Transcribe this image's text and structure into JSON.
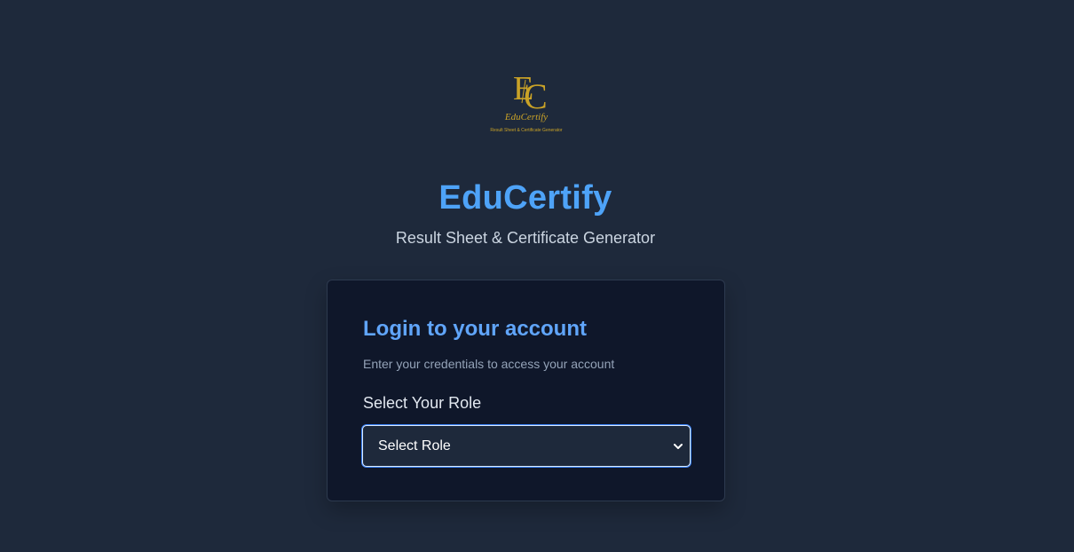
{
  "logo": {
    "monogram_e": "E",
    "monogram_c": "C",
    "wordmark": "EduCertify",
    "tagline": "Result Sheet & Certificate Generator",
    "color": "#c9a227"
  },
  "header": {
    "title": "EduCertify",
    "subtitle": "Result Sheet & Certificate Generator"
  },
  "login": {
    "title": "Login to your account",
    "description": "Enter your credentials to access your account",
    "role_label": "Select Your Role",
    "role_select": {
      "selected": "Select Role"
    }
  },
  "icons": {
    "select_arrow": "chevron-down-icon"
  },
  "colors": {
    "background": "#1e293b",
    "card": "#0f172a",
    "accent": "#4ea3f8",
    "focus_ring": "#3b82f6"
  }
}
